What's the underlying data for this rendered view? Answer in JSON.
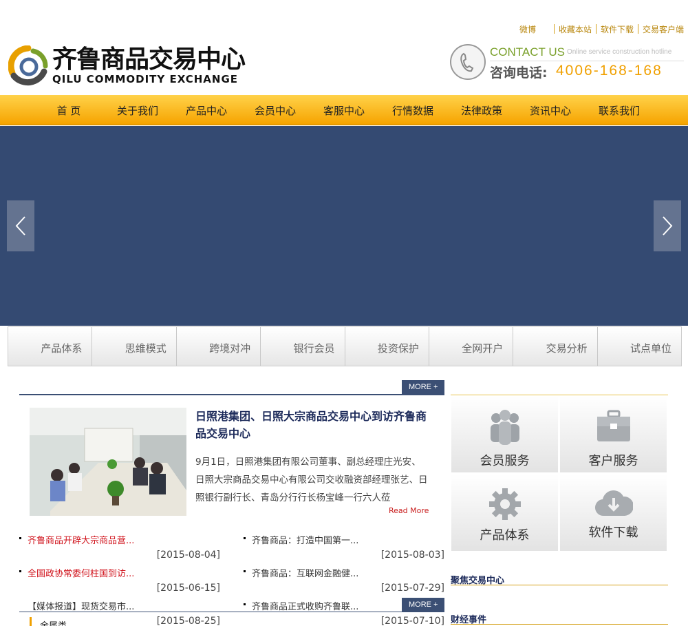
{
  "topbar": {
    "links": [
      "微博",
      "收藏本站",
      "软件下载",
      "交易客户端"
    ]
  },
  "logo": {
    "cn": "齐鲁商品交易中心",
    "en": "QILU COMMODITY EXCHANGE"
  },
  "contact": {
    "title": "CONTACT US",
    "subtitle": "Online service construction hotline",
    "label": "咨询电话:",
    "number": "4006-168-168"
  },
  "nav": [
    "首 页",
    "关于我们",
    "产品中心",
    "会员中心",
    "客服中心",
    "行情数据",
    "法律政策",
    "资讯中心",
    "联系我们"
  ],
  "tabs": [
    "产品体系",
    "思维模式",
    "跨境对冲",
    "银行会员",
    "投资保护",
    "全网开户",
    "交易分析",
    "试点单位"
  ],
  "news": {
    "more_label": "MORE +",
    "headline": "日照港集团、日照大宗商品交易中心到访齐鲁商品交易中心",
    "summary": "9月1日，日照港集团有限公司董事、副总经理庄光安、日照大宗商品交易中心有限公司交收融资部经理张艺、日照银行副行长、青岛分行行长杨宝峰一行六人莅",
    "read_more": "Read More",
    "items": [
      {
        "title": "齐鲁商品开辟大宗商品营...",
        "date": "[2015-08-04]",
        "red": true
      },
      {
        "title": "齐鲁商品：打造中国第一...",
        "date": "[2015-08-03]",
        "red": false
      },
      {
        "title": "全国政协常委何柱国到访...",
        "date": "[2015-06-15]",
        "red": true
      },
      {
        "title": "齐鲁商品：互联网金融健...",
        "date": "[2015-07-29]",
        "red": false
      },
      {
        "title": "【媒体报道】现货交易市...",
        "date": "[2015-08-25]",
        "red": false
      },
      {
        "title": "齐鲁商品正式收购齐鲁联...",
        "date": "[2015-07-10]",
        "red": false
      }
    ],
    "more_label_2": "MORE +",
    "category": "金属类"
  },
  "services": [
    "会员服务",
    "客户服务",
    "产品体系",
    "软件下载"
  ],
  "side": {
    "focus": "聚焦交易中心",
    "finance": "财经事件"
  },
  "colors": {
    "nav_gradient": [
      "#ffd24a",
      "#f6a400"
    ],
    "banner": "#344a72",
    "accent_red": "#d0121b",
    "navy": "#3b4f74"
  }
}
